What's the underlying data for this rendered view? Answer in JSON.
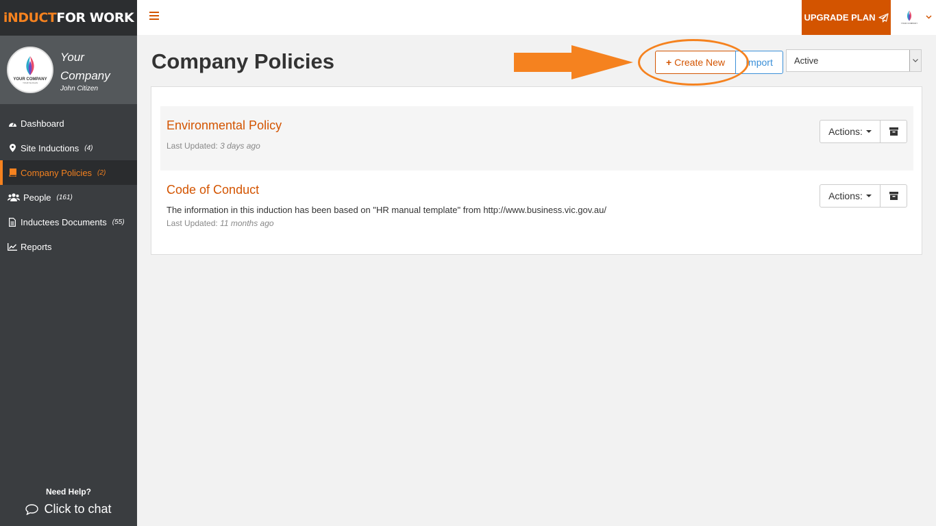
{
  "brand": {
    "part1": "iNDUCT",
    "part2": "FOR WORK"
  },
  "profile": {
    "company": "Your Company",
    "user": "John Citizen",
    "avatar_text": "YOUR COMPANY",
    "avatar_sub": "YOUR SLOGAN"
  },
  "sidebar": {
    "items": [
      {
        "label": "Dashboard",
        "count": "",
        "icon": "dashboard-icon"
      },
      {
        "label": "Site Inductions",
        "count": "(4)",
        "icon": "map-marker-icon"
      },
      {
        "label": "Company Policies",
        "count": "(2)",
        "icon": "book-icon"
      },
      {
        "label": "People",
        "count": "(161)",
        "icon": "users-icon"
      },
      {
        "label": "Inductees Documents",
        "count": "(55)",
        "icon": "file-icon"
      },
      {
        "label": "Reports",
        "count": "",
        "icon": "line-chart-icon"
      }
    ],
    "active_index": 2
  },
  "help": {
    "title": "Need Help?",
    "chat": "Click to chat"
  },
  "topbar": {
    "upgrade_label": "UPGRADE PLAN"
  },
  "page": {
    "title": "Company Policies"
  },
  "toolbar": {
    "create_label": "Create New",
    "import_label": "Import",
    "status_value": "Active"
  },
  "policies": [
    {
      "title": "Environmental Policy",
      "description": "",
      "updated_label": "Last Updated:",
      "updated_value": "3 days ago",
      "actions_label": "Actions:"
    },
    {
      "title": "Code of Conduct",
      "description": "The information in this induction has been based on \"HR manual template\" from http://www.business.vic.gov.au/",
      "updated_label": "Last Updated:",
      "updated_value": "11 months ago",
      "actions_label": "Actions:"
    }
  ],
  "colors": {
    "accent": "#d35400",
    "sidebar": "#3a3d40",
    "annotation": "#f5821f",
    "import": "#3a8fd8"
  }
}
